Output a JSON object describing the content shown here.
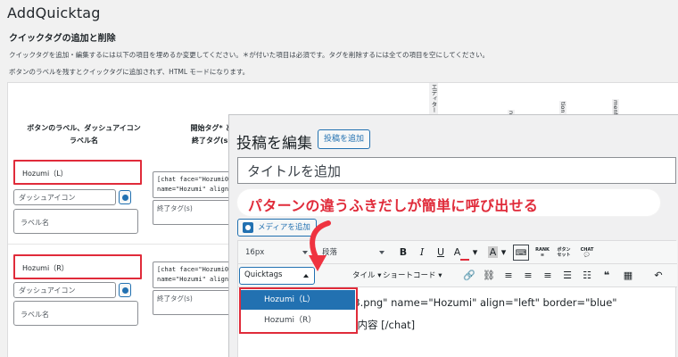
{
  "app": {
    "title": "AddQuicktag",
    "section_title": "クイックタグの追加と削除",
    "desc1": "クイックタグを追加・編集するには以下の項目を埋めるか変更してください。＊が付いた項目は必須です。タグを削除するには全ての項目を空にしてください。",
    "desc2": "ボタンのラベルを残すとクイックタグに追加されず、HTML モードになります。"
  },
  "settings": {
    "col_label_1": "ボタンのラベル、ダッシュアイコン",
    "col_label_2": "ラベル名",
    "col_start_1": "開始タグ* と",
    "col_start_2": "終了タグ(s)",
    "vertical_headers": [
      "エディター",
      "nt",
      "tion",
      "ments"
    ],
    "rows": [
      {
        "button_label": "Hozumi（L）",
        "dashicon_placeholder": "ダッシュアイコン",
        "label_placeholder": "ラベル名",
        "start_line1": "[chat face=\"Hozumi0",
        "start_line2": "name=\"Hozumi\" align",
        "end_placeholder": "終了タグ(s)"
      },
      {
        "button_label": "Hozumi（R）",
        "dashicon_placeholder": "ダッシュアイコン",
        "label_placeholder": "ラベル名",
        "start_line1": "[chat face=\"Hozumi0",
        "start_line2": "name=\"Hozumi\" align",
        "end_placeholder": "終了タグ(s)"
      }
    ]
  },
  "editor": {
    "heading": "投稿を編集",
    "add_post_label": "投稿を追加",
    "title_placeholder": "タイトルを追加",
    "callout_text": "パターンの違うふきだしが簡単に呼び出せる",
    "media_label": "メディアを追加",
    "font_size": "16px",
    "paragraph": "段落",
    "bold": "B",
    "italic": "I",
    "underline": "U",
    "text_color": "A",
    "bg_color": "A",
    "rank_label": "RANK",
    "button_label_1": "ボタン",
    "button_label_2": "セット",
    "chat_label": "CHAT",
    "quicktags_label": "Quicktags",
    "style_label": "タイル",
    "shortcode_label": "ショートコード",
    "content_line1": "03.png\" name=\"Hozumi\" align=\"left\" border=\"blue\"",
    "content_line2": "の内容 [/chat]"
  },
  "dropdown": {
    "items": [
      "Hozumi（L）",
      "Hozumi（R）"
    ],
    "selected": "Hozumi（L）"
  },
  "colors": {
    "highlight_red": "#e02b3a",
    "wp_blue": "#2271b1",
    "arrow_red": "#ef3340"
  }
}
